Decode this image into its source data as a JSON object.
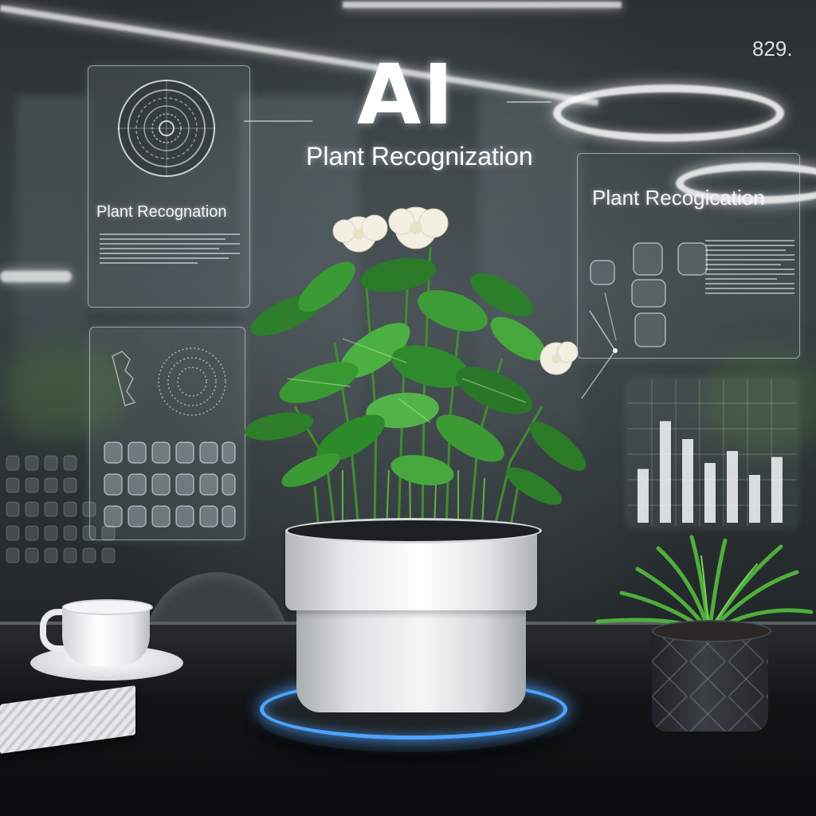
{
  "image": {
    "subject": "potted plant on glowing base with holographic plant recognition displays",
    "colors": {
      "glow_ring": "#4fa3ff",
      "leaf_dark": "#1f6f2a",
      "leaf_light": "#4cae3a",
      "flower": "#f3efe2",
      "pot": "#f2f3f3"
    }
  },
  "overlay": {
    "title": "AI",
    "subtitle": "Plant Recognization",
    "corner_number": "829."
  },
  "left_panel_top": {
    "label": "Plant Recognation",
    "icon": "fingerprint-icon"
  },
  "left_panel_bottom": {
    "icon": "fingerprint-grid-icon"
  },
  "right_panel": {
    "label": "Plant Recogication",
    "chart": {
      "bar_heights": [
        0.45,
        0.85,
        0.7,
        0.5,
        0.6,
        0.4,
        0.55
      ]
    }
  }
}
